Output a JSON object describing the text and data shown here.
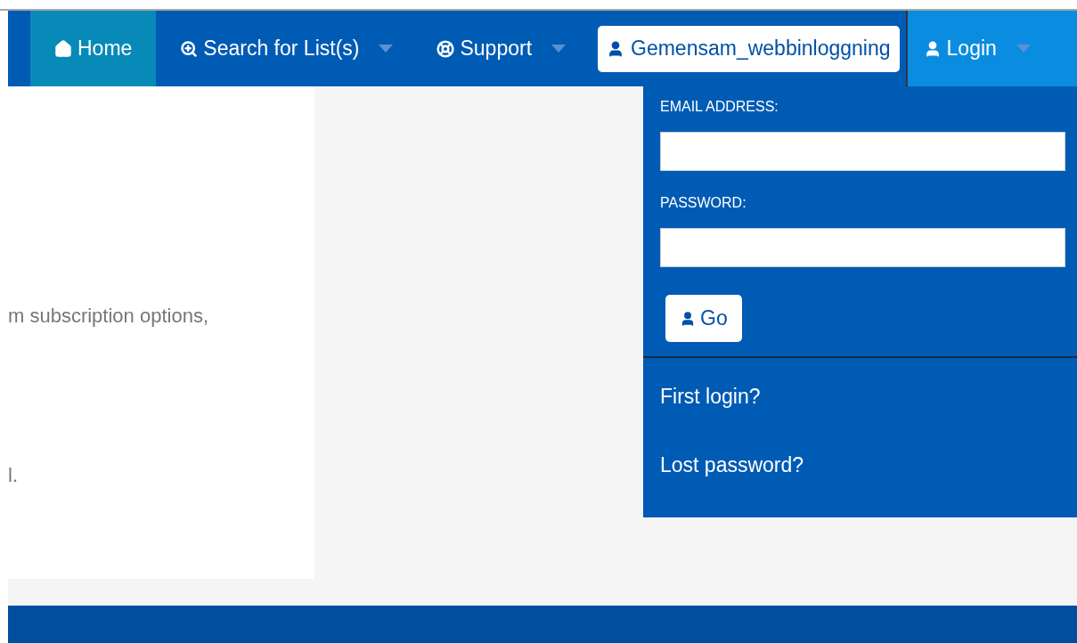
{
  "nav": {
    "items": [
      {
        "label": "Home",
        "selected": true,
        "caret": false
      },
      {
        "label": "Search for List(s)",
        "selected": false,
        "caret": true
      },
      {
        "label": "Support",
        "selected": false,
        "caret": true
      }
    ],
    "account": {
      "label": "Gemensam_webbinloggning"
    },
    "login": {
      "label": "Login",
      "expanded": true,
      "caret": true
    }
  },
  "login_menu": {
    "fields": [
      {
        "label": "EMAIL ADDRESS:"
      },
      {
        "label": "PASSWORD:"
      }
    ],
    "button": "Go",
    "links": [
      "First login?",
      "Lost password?"
    ]
  },
  "content": {
    "lines": [
      "m subscription options,",
      "l."
    ]
  }
}
